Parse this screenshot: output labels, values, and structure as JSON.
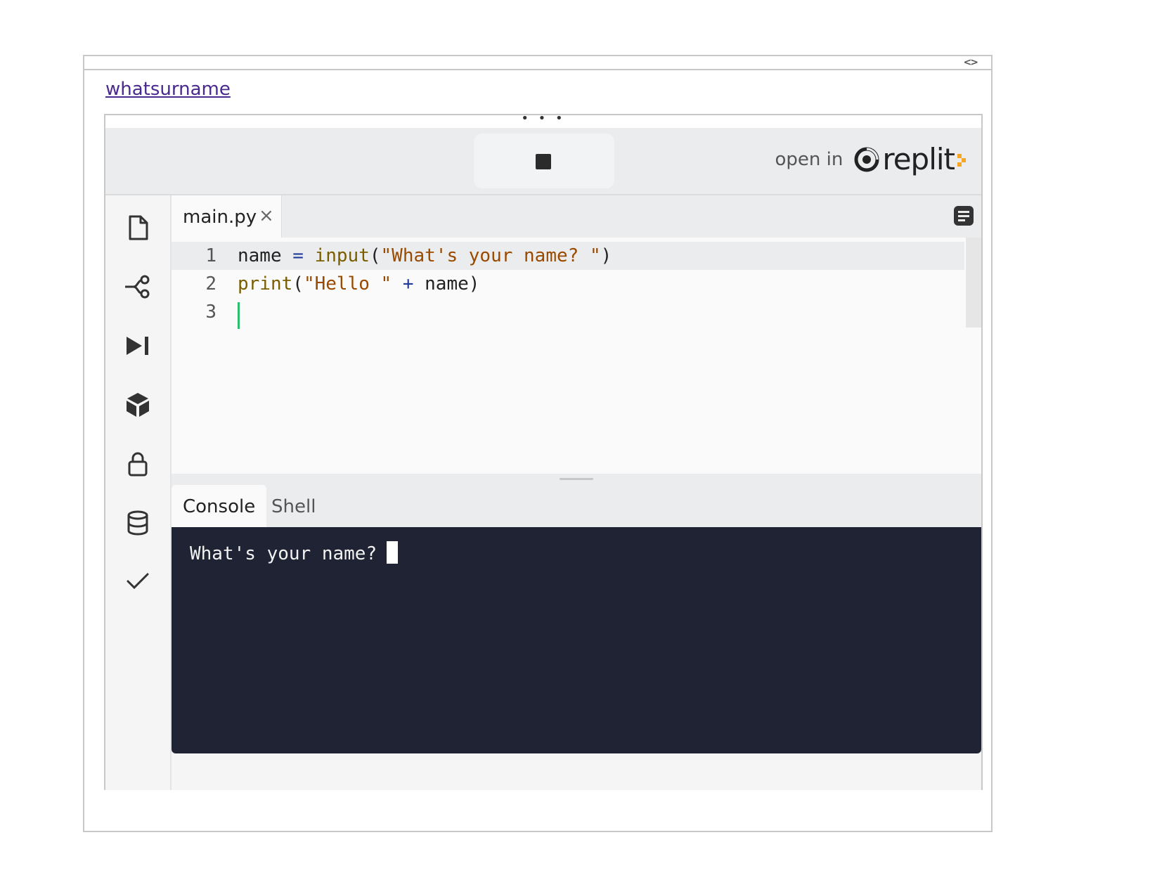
{
  "embed": {
    "link_text": "whatsurname",
    "drag_handle": "• • •"
  },
  "topbar": {
    "run_button_state": "stop",
    "open_in_label": "open in",
    "brand": "replit",
    "brand_accent_color": "#f5a623"
  },
  "sidebar": {
    "items": [
      {
        "name": "files",
        "icon": "file-icon"
      },
      {
        "name": "version-control",
        "icon": "git-branch-icon"
      },
      {
        "name": "debugger",
        "icon": "step-forward-icon"
      },
      {
        "name": "packages",
        "icon": "package-cube-icon"
      },
      {
        "name": "secrets",
        "icon": "lock-icon"
      },
      {
        "name": "database",
        "icon": "database-icon"
      },
      {
        "name": "unit-tests",
        "icon": "checkmark-icon"
      }
    ]
  },
  "editor": {
    "tab_name": "main.py",
    "close_glyph": "×",
    "lines": [
      {
        "number": "1"
      },
      {
        "number": "2"
      },
      {
        "number": "3"
      }
    ],
    "code": {
      "l1_var": "name",
      "l1_eq": " = ",
      "l1_fn": "input",
      "l1_open": "(",
      "l1_str": "\"What's your name? \"",
      "l1_close": ")",
      "l2_fn": "print",
      "l2_open": "(",
      "l2_str": "\"Hello \"",
      "l2_plus": " + ",
      "l2_var": "name",
      "l2_close": ")"
    }
  },
  "console": {
    "tabs": [
      "Console",
      "Shell"
    ],
    "output": "What's your name?"
  }
}
